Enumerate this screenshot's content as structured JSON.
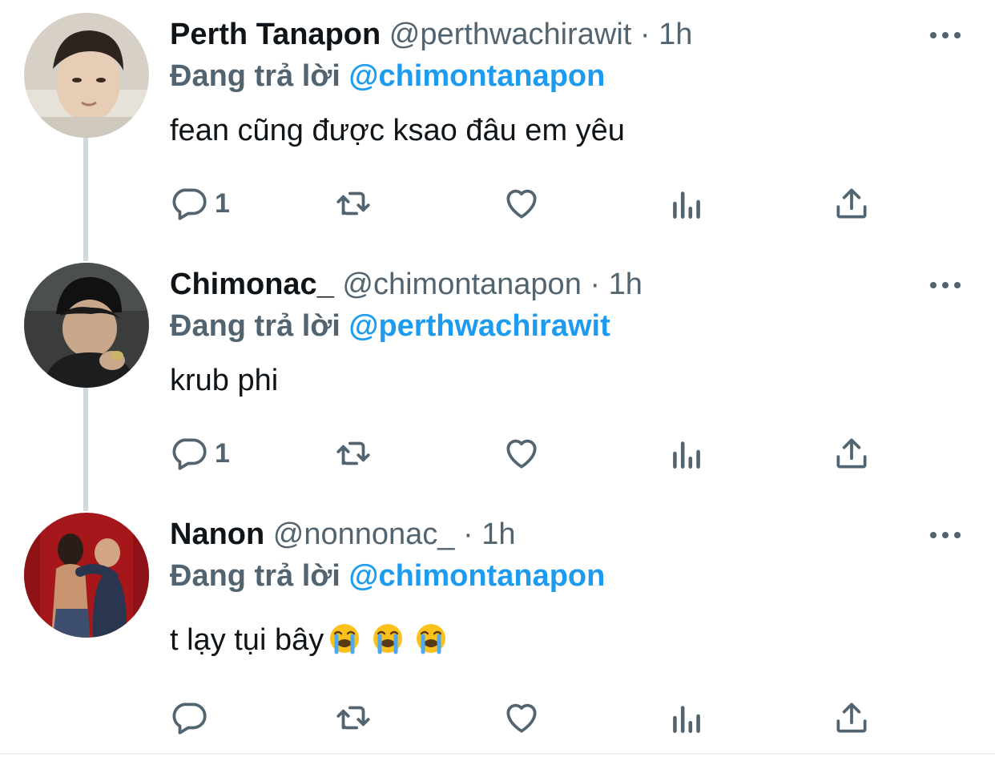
{
  "tweets": [
    {
      "name": "Perth Tanapon",
      "handle": "@perthwachirawit",
      "separator": "·",
      "time": "1h",
      "reply_prefix": "Đang trả lời",
      "reply_to": "@chimontanapon",
      "text": "fean cũng được ksao đâu em yêu",
      "reply_count": "1",
      "avatar_colors": [
        "#d8d2c8",
        "#3a2f28",
        "#e9d7c4"
      ]
    },
    {
      "name": "Chimonac_",
      "handle": "@chimontanapon",
      "separator": "·",
      "time": "1h",
      "reply_prefix": "Đang trả lời",
      "reply_to": "@perthwachirawit",
      "text": "krub phi",
      "reply_count": "1",
      "avatar_colors": [
        "#2f3230",
        "#111111",
        "#c9a98e"
      ]
    },
    {
      "name": "Nanon",
      "handle": "@nonnonac_",
      "separator": "·",
      "time": "1h",
      "reply_prefix": "Đang trả lời",
      "reply_to": "@chimontanapon",
      "text": "t lạy tụi bây",
      "reply_count": "",
      "emoji_count": 3,
      "avatar_colors": [
        "#a6171c",
        "#c8946f",
        "#2a3550"
      ]
    }
  ],
  "icons": {
    "more": "more-icon",
    "reply": "reply-icon",
    "retweet": "retweet-icon",
    "like": "like-icon",
    "views": "views-icon",
    "share": "share-icon",
    "emoji": "crying-face-emoji-icon"
  },
  "colors": {
    "link": "#1d9bf0",
    "secondary": "#536471",
    "primary": "#0f1419",
    "thread_line": "#cfd9de"
  }
}
